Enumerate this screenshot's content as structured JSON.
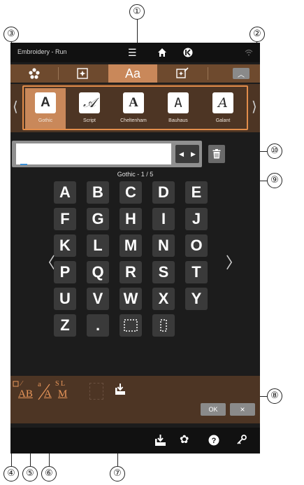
{
  "callouts": [
    "①",
    "②",
    "③",
    "④",
    "⑤",
    "⑥",
    "⑦",
    "⑧",
    "⑨",
    "⑩"
  ],
  "statusbar": {
    "title": "Embroidery - Run",
    "icons": [
      "menu-icon",
      "home-icon",
      "jump-icon",
      "wifi-icon"
    ]
  },
  "tabs": [
    {
      "name": "design-tab",
      "icon": "flower-icon"
    },
    {
      "name": "pattern-tab",
      "icon": "stitch-pattern-icon"
    },
    {
      "name": "font-tab",
      "label": "Aa",
      "active": true
    },
    {
      "name": "edit-tab",
      "icon": "edit-pattern-icon"
    },
    {
      "name": "collapse-tab",
      "label": "︿"
    }
  ],
  "fonts": [
    {
      "glyph": "A",
      "label": "Gothic",
      "selected": true
    },
    {
      "glyph": "𝒜",
      "label": "Script",
      "selected": false
    },
    {
      "glyph": "A",
      "label": "Cheltenham",
      "selected": false
    },
    {
      "glyph": "A",
      "label": "Bauhaus",
      "selected": false
    },
    {
      "glyph": "A",
      "label": "Galant",
      "selected": false
    }
  ],
  "font_nav": {
    "left": "⟨",
    "right": "⟩"
  },
  "input": {
    "value": "",
    "prev": "◀",
    "next": "▶"
  },
  "page_indicator": "Gothic - 1 / 5",
  "keys": [
    "A",
    "B",
    "C",
    "D",
    "E",
    "F",
    "G",
    "H",
    "I",
    "J",
    "K",
    "L",
    "M",
    "N",
    "O",
    "P",
    "Q",
    "R",
    "S",
    "T",
    "U",
    "V",
    "W",
    "X",
    "Y",
    "Z",
    "."
  ],
  "grid_nav": {
    "left": "〈",
    "right": "〉"
  },
  "bottom": {
    "option4": {
      "top": "⁄",
      "text": "AB"
    },
    "option5": {
      "top": "a",
      "text": "A"
    },
    "option6": {
      "top": "S L",
      "text": "M"
    },
    "ok_label": "OK",
    "cancel_label": "×"
  },
  "footer_icons": [
    "import-icon",
    "settings-icon",
    "help-icon",
    "key-icon"
  ]
}
